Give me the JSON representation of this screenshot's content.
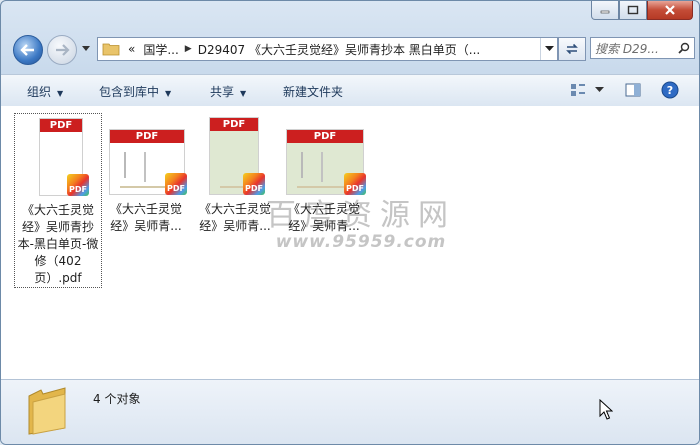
{
  "window": {
    "caption_buttons": {
      "minimize": "minimize",
      "maximize": "maximize",
      "close": "close"
    }
  },
  "nav": {
    "address": {
      "overflow": "«",
      "segments": [
        "国学...",
        "D29407 《大六壬灵觉经》吴师青抄本 黑白单页（..."
      ]
    },
    "search_placeholder": "搜索 D29..."
  },
  "toolbar": {
    "organize": "组织",
    "include_in_library": "包含到库中",
    "share": "共享",
    "new_folder": "新建文件夹"
  },
  "files": [
    {
      "name": "《大六壬灵觉经》吴师青抄本-黑白单页-微修（402页）.pdf",
      "badge": "PDF",
      "selected": true
    },
    {
      "name": "《大六壬灵觉经》吴师青...",
      "badge": "PDF",
      "selected": false
    },
    {
      "name": "《大六壬灵觉经》吴师青...",
      "badge": "PDF",
      "selected": false
    },
    {
      "name": "《大六壬灵觉经》吴师青...",
      "badge": "PDF",
      "selected": false
    }
  ],
  "watermark": {
    "top": "百度资源网",
    "bottom": "www.95959.com"
  },
  "status": {
    "count": "4 个对象"
  }
}
